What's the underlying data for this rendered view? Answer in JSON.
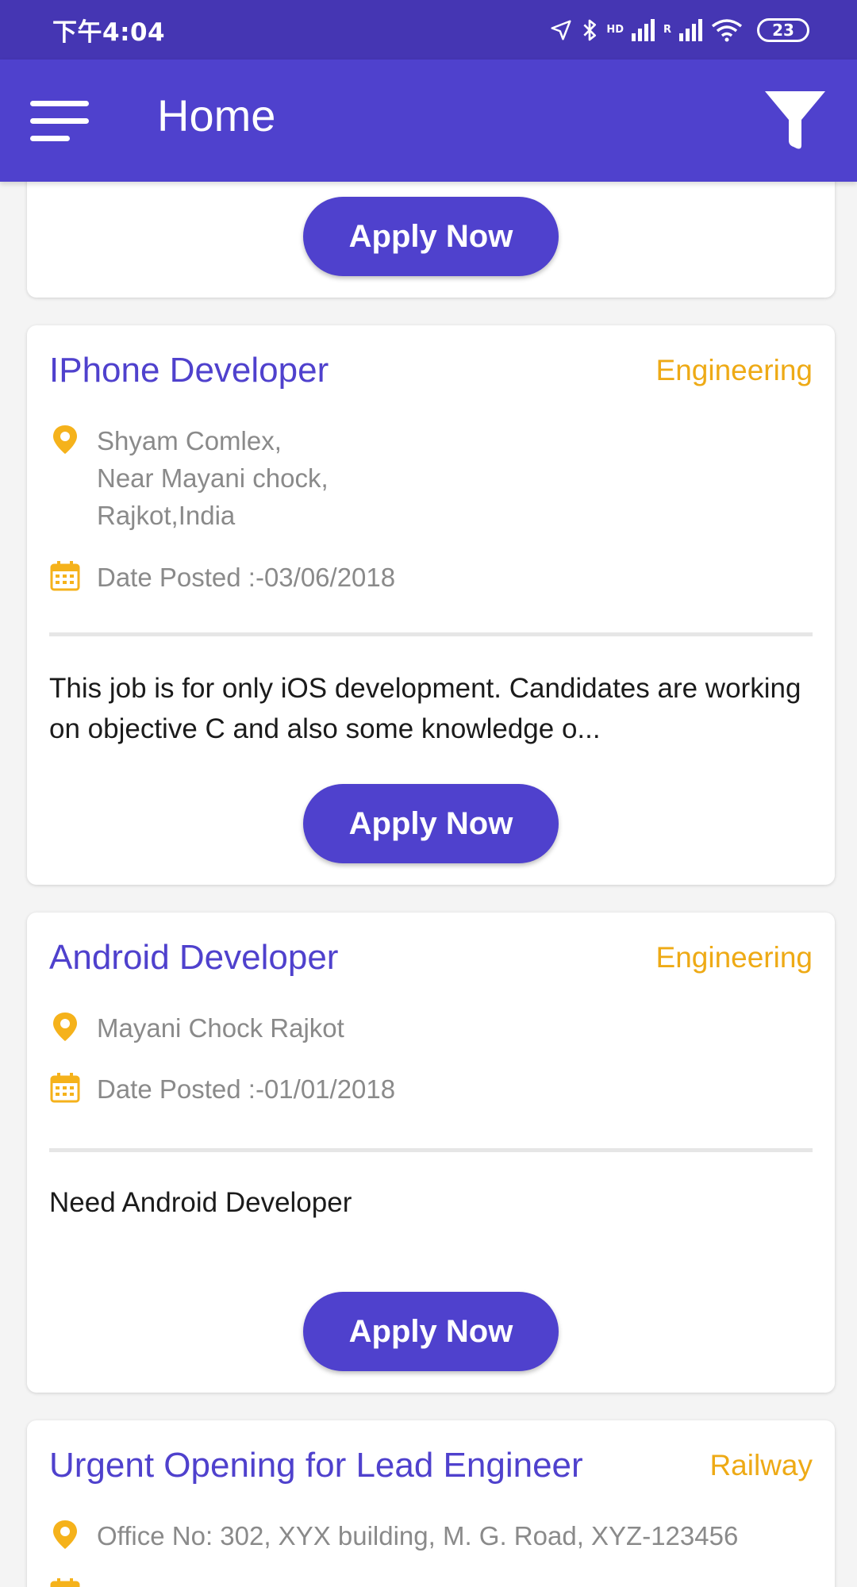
{
  "status_bar": {
    "time": "下午4:04",
    "network_1": "HD",
    "network_2": "R",
    "battery": "23"
  },
  "app_bar": {
    "title": "Home",
    "menu_icon": "hamburger-menu-icon",
    "filter_icon": "filter-funnel-icon"
  },
  "colors": {
    "primary": "#4f41cd",
    "status_bar": "#4536b3",
    "accent": "#eeaa15",
    "background": "#f4f4f4"
  },
  "cards": [
    {
      "apply_label": "Apply Now"
    },
    {
      "title": "IPhone Developer",
      "category": "Engineering",
      "location": "Shyam Comlex,\nNear Mayani chock,\nRajkot,India",
      "date_posted": "Date Posted :-03/06/2018",
      "description": "This job is for only iOS development. Candidates are working on objective C and also some knowledge o...",
      "apply_label": "Apply Now"
    },
    {
      "title": "Android Developer",
      "category": "Engineering",
      "location": "Mayani Chock Rajkot",
      "date_posted": "Date Posted :-01/01/2018",
      "description": "Need Android Developer",
      "apply_label": "Apply Now"
    },
    {
      "title": "Urgent Opening for Lead Engineer",
      "category": "Railway",
      "location": "Office No: 302, XYX building, M. G. Road, XYZ-123456"
    }
  ]
}
